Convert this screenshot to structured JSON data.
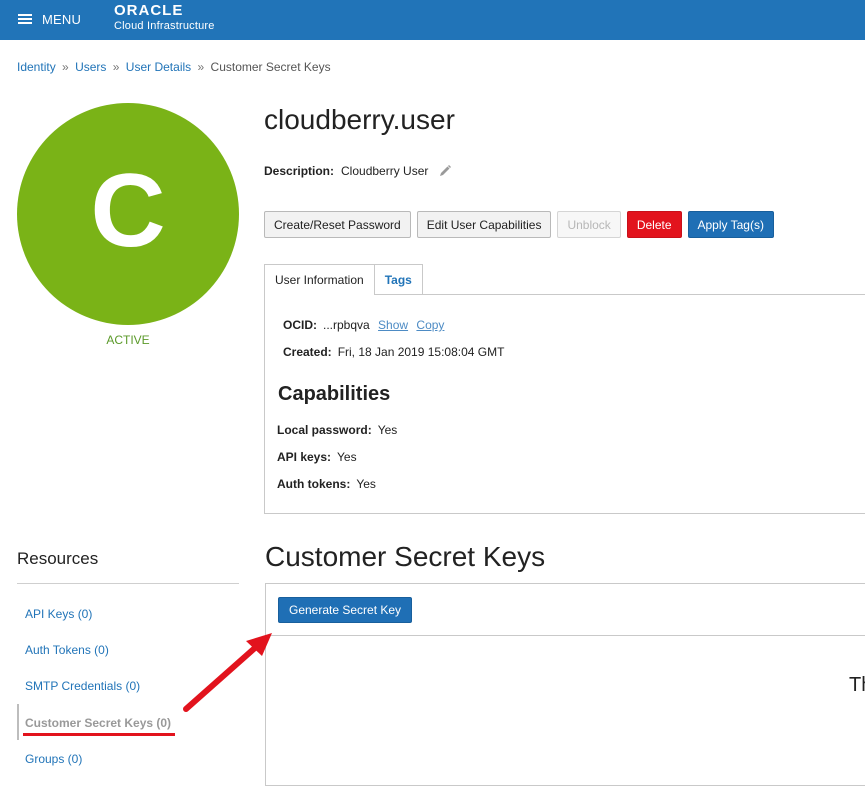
{
  "topbar": {
    "menu_label": "MENU",
    "brand_name": "ORACLE",
    "brand_sub": "Cloud Infrastructure"
  },
  "breadcrumb": {
    "items": [
      "Identity",
      "Users",
      "User Details"
    ],
    "current": "Customer Secret Keys",
    "separator": "»"
  },
  "avatar": {
    "letter": "C",
    "status": "ACTIVE",
    "color": "#7ab317"
  },
  "user": {
    "name": "cloudberry.user",
    "description_label": "Description:",
    "description_value": "Cloudberry User"
  },
  "actions": {
    "create_reset_password": "Create/Reset Password",
    "edit_capabilities": "Edit User Capabilities",
    "unblock": "Unblock",
    "delete": "Delete",
    "apply_tags": "Apply Tag(s)"
  },
  "tabs": {
    "user_information": "User Information",
    "tags": "Tags"
  },
  "info": {
    "ocid_label": "OCID:",
    "ocid_value": "...rpbqva",
    "show": "Show",
    "copy": "Copy",
    "created_label": "Created:",
    "created_value": "Fri, 18 Jan 2019 15:08:04 GMT"
  },
  "capabilities": {
    "title": "Capabilities",
    "local_password_label": "Local password:",
    "local_password_value": "Yes",
    "api_keys_label": "API keys:",
    "api_keys_value": "Yes",
    "auth_tokens_label": "Auth tokens:",
    "auth_tokens_value": "Yes"
  },
  "resources": {
    "title": "Resources",
    "items": [
      "API Keys (0)",
      "Auth Tokens (0)",
      "SMTP Credentials (0)",
      "Customer Secret Keys (0)",
      "Groups (0)"
    ],
    "active_index": 3
  },
  "secret_keys": {
    "title": "Customer Secret Keys",
    "generate_button": "Generate Secret Key",
    "empty_text": "Th"
  },
  "colors": {
    "topbar": "#2174b8",
    "link": "#2174b8",
    "primary_button": "#1f6fb5",
    "danger_button": "#e2131d",
    "annotation": "#e2131d"
  }
}
